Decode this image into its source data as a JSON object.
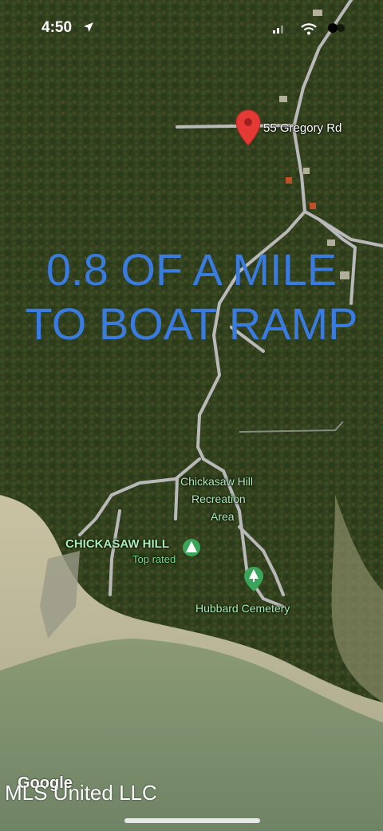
{
  "status_bar": {
    "time": "4:50",
    "icons": [
      "location-arrow-icon",
      "signal-icon",
      "wifi-icon",
      "battery-icon"
    ]
  },
  "overlay": {
    "line1": "0.8 OF A MILE",
    "line2": "TO BOAT RAMP",
    "color": "#3a7be0"
  },
  "map": {
    "pin_label": "55 Gregory Rd",
    "pin_color": "#e53935",
    "poi": {
      "recreation_area_line1": "Chickasaw Hill",
      "recreation_area_line2": "Recreation",
      "recreation_area_line3": "Area",
      "park_name": "CHICKASAW HILL",
      "park_sub": "Top rated",
      "cemetery": "Hubbard Cemetery"
    },
    "poi_color": "#3aa55a",
    "google_logo": "Google"
  },
  "watermark": "MLS United LLC"
}
